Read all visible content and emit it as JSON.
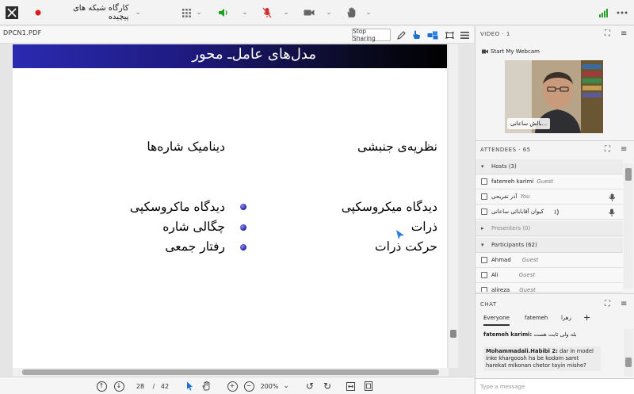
{
  "topbar": {
    "room_title": "کارگاه شبکه های پیچیده",
    "icons": [
      "app-logo-icon",
      "record-icon",
      "grid-apps-icon",
      "speaker-icon",
      "mic-muted-icon",
      "camera-icon",
      "raise-hand-icon",
      "signal-bars-icon"
    ]
  },
  "doc": {
    "filename": "DPCN1.PDF",
    "stop_sharing": "Stop Sharing"
  },
  "slide": {
    "title": "مدل‌های عامل‌ـ محور",
    "left_heading": "دینامیک شاره‌ها",
    "right_heading": "نظریه‌ی جنبشی",
    "left_items": [
      "دیدگاه ماکروسکپی",
      "چگالی شاره",
      "رفتار جمعی"
    ],
    "right_items": [
      "دیدگاه میکروسکپی",
      "ذرات",
      "حرکت ذرات"
    ],
    "colors": {
      "header_start": "#2b2ab0",
      "header_end": "#000000",
      "bullet": "#22229a"
    }
  },
  "bottombar": {
    "page_current": "28",
    "page_separator": "/",
    "page_total": "42",
    "zoom": "200%"
  },
  "video": {
    "header": "VIDEO",
    "count": "1",
    "webcam_button": "Start My Webcam",
    "participant_name": "...بالش ساعانی"
  },
  "attendees": {
    "header": "ATTENDEES",
    "count": "65",
    "hosts_label": "Hosts (3)",
    "hosts": [
      {
        "name": "fatemeh karimi",
        "role": "Guest"
      },
      {
        "name": "آذر تفریحی",
        "role": "You"
      },
      {
        "name": "کیوان آقابابائی ساعانی",
        "role": ""
      }
    ],
    "presenters_label": "Presenters (0)",
    "participants_label": "Participants (62)",
    "participants": [
      {
        "name": "Ahmad",
        "role": "Guest"
      },
      {
        "name": "Ali",
        "role": "Guest"
      },
      {
        "name": "alireza",
        "role": "Guest"
      }
    ]
  },
  "chat": {
    "header": "CHAT",
    "tabs": [
      "Everyone",
      "fatemeh",
      "زهرا"
    ],
    "add_tab": "+",
    "messages": [
      {
        "sender": "fatemeh karimi:",
        "text": "بله ولی ثابت هست"
      },
      {
        "sender": "Mohammadali.Habibi 2:",
        "text": "dar in model inke khargoosh ha be kodom samt harekat mikonan chetor tayin mishe?"
      }
    ],
    "placeholder": "Type a message"
  }
}
